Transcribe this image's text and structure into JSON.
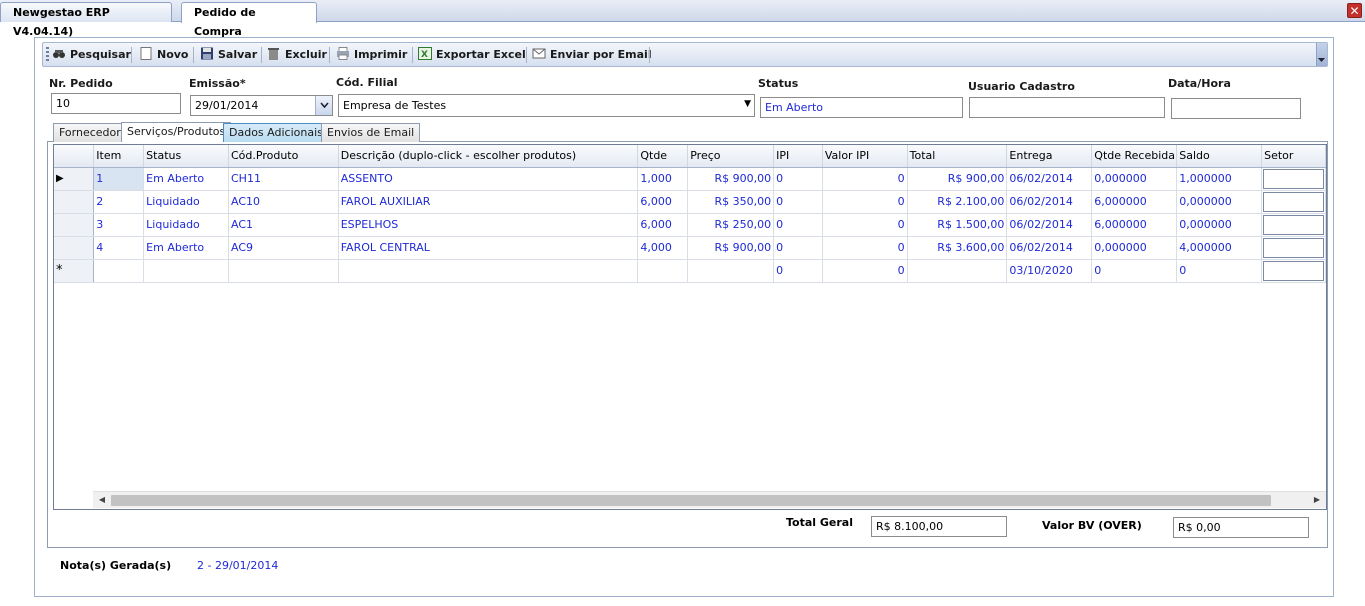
{
  "window_tabs": [
    {
      "label": "Newgestao ERP V4.04.14)"
    },
    {
      "label": "Pedido de Compra"
    }
  ],
  "close_icon": "close-icon",
  "toolbar": {
    "items": [
      {
        "label": "Pesquisar",
        "icon": "binoculars-icon"
      },
      {
        "label": "Novo",
        "icon": "new-document-icon"
      },
      {
        "label": "Salvar",
        "icon": "floppy-disk-icon"
      },
      {
        "label": "Excluir",
        "icon": "delete-icon"
      },
      {
        "label": "Imprimir",
        "icon": "printer-icon"
      },
      {
        "label": "Exportar Excel",
        "icon": "excel-icon"
      },
      {
        "label": "Enviar por Email",
        "icon": "envelope-icon"
      }
    ]
  },
  "form": {
    "nr_pedido_label": "Nr. Pedido",
    "nr_pedido_value": "10",
    "emissao_label": "Emissão*",
    "emissao_value": "29/01/2014",
    "filial_label": "Cód. Filial",
    "filial_value": "Empresa de Testes",
    "status_label": "Status",
    "status_value": "Em Aberto",
    "usuario_label": "Usuario Cadastro",
    "usuario_value": "",
    "datahora_label": "Data/Hora",
    "datahora_value": ""
  },
  "inner_tabs": [
    {
      "label": "Fornecedor"
    },
    {
      "label": "Serviços/Produtos"
    },
    {
      "label": "Dados Adicionais"
    },
    {
      "label": "Envios de Email"
    }
  ],
  "grid": {
    "columns": [
      "Item",
      "Status",
      "Cód.Produto",
      "Descrição (duplo-click - escolher produtos)",
      "Qtde",
      "Preço",
      "IPI",
      "Valor IPI",
      "Total",
      "Entrega",
      "Qtde Recebida",
      "Saldo",
      "Setor"
    ],
    "rows": [
      {
        "marker": "▶",
        "item": "1",
        "status": "Em Aberto",
        "codigo": "CH11",
        "descricao": "ASSENTO",
        "qtde": "1,000",
        "preco": "R$ 900,00",
        "ipi": "0",
        "valor_ipi": "0",
        "total": "R$ 900,00",
        "entrega": "06/02/2014",
        "qtde_recebida": "0,000000",
        "saldo": "1,000000",
        "setor": ""
      },
      {
        "marker": "",
        "item": "2",
        "status": "Liquidado",
        "codigo": "AC10",
        "descricao": "FAROL AUXILIAR",
        "qtde": "6,000",
        "preco": "R$ 350,00",
        "ipi": "0",
        "valor_ipi": "0",
        "total": "R$ 2.100,00",
        "entrega": "06/02/2014",
        "qtde_recebida": "6,000000",
        "saldo": "0,000000",
        "setor": ""
      },
      {
        "marker": "",
        "item": "3",
        "status": "Liquidado",
        "codigo": "AC1",
        "descricao": "ESPELHOS",
        "qtde": "6,000",
        "preco": "R$ 250,00",
        "ipi": "0",
        "valor_ipi": "0",
        "total": "R$ 1.500,00",
        "entrega": "06/02/2014",
        "qtde_recebida": "6,000000",
        "saldo": "0,000000",
        "setor": ""
      },
      {
        "marker": "",
        "item": "4",
        "status": "Em Aberto",
        "codigo": "AC9",
        "descricao": "FAROL CENTRAL",
        "qtde": "4,000",
        "preco": "R$ 900,00",
        "ipi": "0",
        "valor_ipi": "0",
        "total": "R$ 3.600,00",
        "entrega": "06/02/2014",
        "qtde_recebida": "0,000000",
        "saldo": "4,000000",
        "setor": ""
      },
      {
        "marker": "*",
        "item": "",
        "status": "",
        "codigo": "",
        "descricao": "",
        "qtde": "",
        "preco": "",
        "ipi": "0",
        "valor_ipi": "0",
        "total": "",
        "entrega": "03/10/2020",
        "qtde_recebida": "0",
        "saldo": "0",
        "setor": ""
      }
    ]
  },
  "totals": {
    "total_geral_label": "Total Geral",
    "total_geral_value": "R$ 8.100,00",
    "valor_bv_label": "Valor BV (OVER)",
    "valor_bv_value": "R$ 0,00"
  },
  "notas": {
    "label": "Nota(s) Gerada(s)",
    "value": "2 - 29/01/2014"
  }
}
